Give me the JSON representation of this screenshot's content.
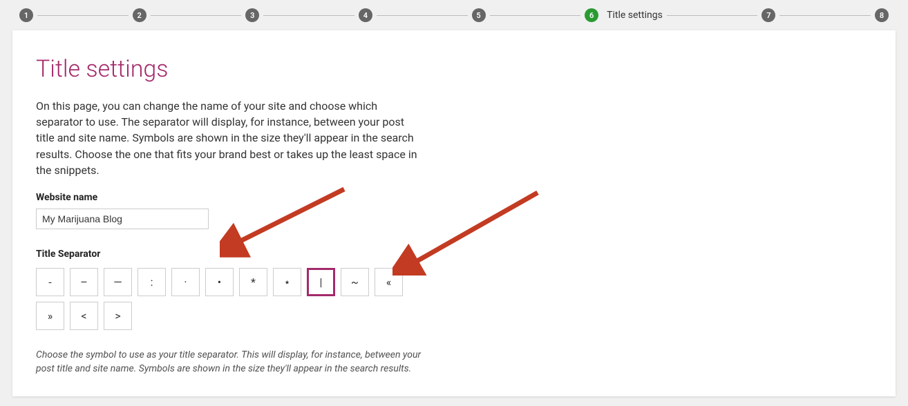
{
  "stepper": {
    "steps": [
      {
        "num": "1",
        "label": "",
        "active": false
      },
      {
        "num": "2",
        "label": "",
        "active": false
      },
      {
        "num": "3",
        "label": "",
        "active": false
      },
      {
        "num": "4",
        "label": "",
        "active": false
      },
      {
        "num": "5",
        "label": "",
        "active": false
      },
      {
        "num": "6",
        "label": "Title settings",
        "active": true
      },
      {
        "num": "7",
        "label": "",
        "active": false
      },
      {
        "num": "8",
        "label": "",
        "active": false
      }
    ]
  },
  "page": {
    "heading": "Title settings",
    "description": "On this page, you can change the name of your site and choose which separator to use. The separator will display, for instance, between your post title and site name. Symbols are shown in the size they'll appear in the search results. Choose the one that fits your brand best or takes up the least space in the snippets.",
    "website_name_label": "Website name",
    "website_name_value": "My Marijuana Blog",
    "separator_label": "Title Separator",
    "separators": [
      {
        "sym": "-",
        "selected": false
      },
      {
        "sym": "–",
        "selected": false
      },
      {
        "sym": "—",
        "selected": false
      },
      {
        "sym": ":",
        "selected": false
      },
      {
        "sym": "·",
        "selected": false
      },
      {
        "sym": "•",
        "selected": false
      },
      {
        "sym": "*",
        "selected": false
      },
      {
        "sym": "⋆",
        "selected": false
      },
      {
        "sym": "|",
        "selected": true
      },
      {
        "sym": "~",
        "selected": false
      },
      {
        "sym": "«",
        "selected": false
      },
      {
        "sym": "»",
        "selected": false
      },
      {
        "sym": "<",
        "selected": false
      },
      {
        "sym": ">",
        "selected": false
      }
    ],
    "helper_text": "Choose the symbol to use as your title separator. This will display, for instance, between your post title and site name. Symbols are shown in the size they'll appear in the search results."
  },
  "annotations": {
    "arrows": [
      {
        "target": "website-name-input"
      },
      {
        "target": "separator-selected"
      }
    ]
  }
}
